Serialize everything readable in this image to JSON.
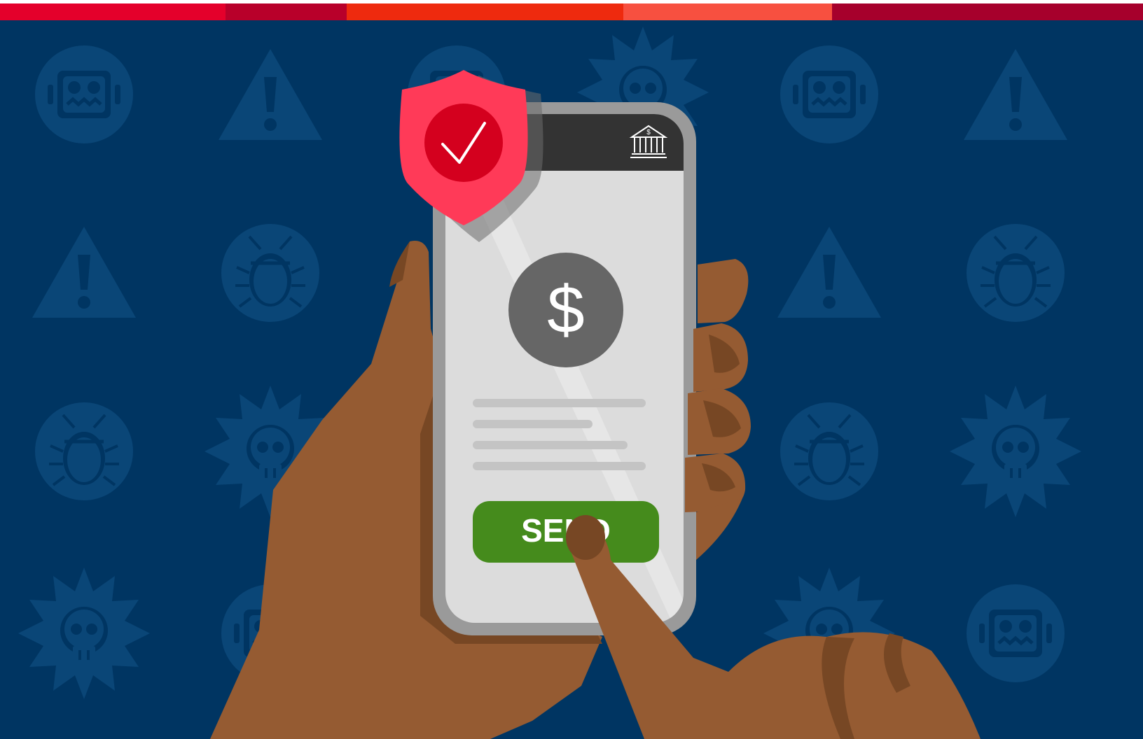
{
  "colors": {
    "background": "#003562",
    "pattern_icon": "#0a4677",
    "stripes": [
      "#e4002b",
      "#b8002a",
      "#ee2a0e",
      "#f75040",
      "#a6002c"
    ],
    "phone_body": "#9a9a9a",
    "phone_screen": "#dcdcdc",
    "phone_header": "#333333",
    "dollar_circle": "#666666",
    "text_lines": "#c4c4c4",
    "send_button": "#458b1c",
    "shield_outer": "#ff3a58",
    "shield_inner": "#d4001e",
    "skin": "#955b32",
    "skin_shadow": "#774724"
  },
  "background_pattern_icons": [
    "robot-icon",
    "warning-icon",
    "virus-skull-icon",
    "bug-icon",
    "warning-icon"
  ],
  "phone": {
    "header_icon": "bank-icon",
    "amount_icon": "dollar-sign-icon",
    "amount_symbol": "$",
    "send_label": "SEND",
    "detail_lines": 4
  },
  "shield": {
    "icon": "checkmark-shield-icon"
  }
}
